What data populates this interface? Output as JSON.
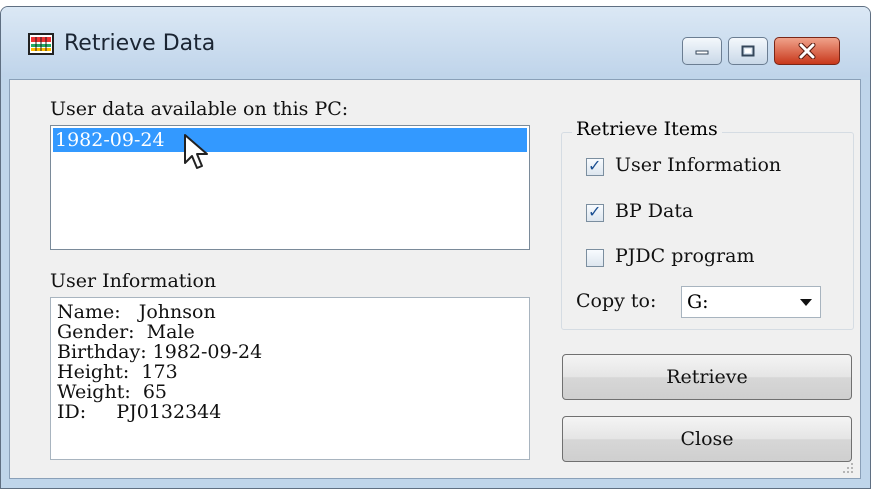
{
  "window": {
    "title": "Retrieve Data"
  },
  "users": {
    "label": "User data available on this PC:",
    "items": [
      "1982-09-24"
    ]
  },
  "user_info": {
    "label": "User Information",
    "rows": [
      "Name:   Johnson",
      "Gender:  Male",
      "Birthday: 1982-09-24",
      "Height:  173",
      "Weight:  65",
      "ID:     PJ0132344"
    ]
  },
  "retrieve_items": {
    "title": "Retrieve Items",
    "user_information": {
      "label": "User Information",
      "checked": true
    },
    "bp_data": {
      "label": "BP Data",
      "checked": true
    },
    "pjdc_program": {
      "label": "PJDC program",
      "checked": false
    },
    "copy_to": {
      "label": "Copy to:",
      "value": "G:"
    }
  },
  "buttons": {
    "retrieve": "Retrieve",
    "close": "Close"
  },
  "colors": {
    "selection": "#3399ff",
    "close_button": "#c8381b",
    "title_bar": "#bfd4ea"
  }
}
